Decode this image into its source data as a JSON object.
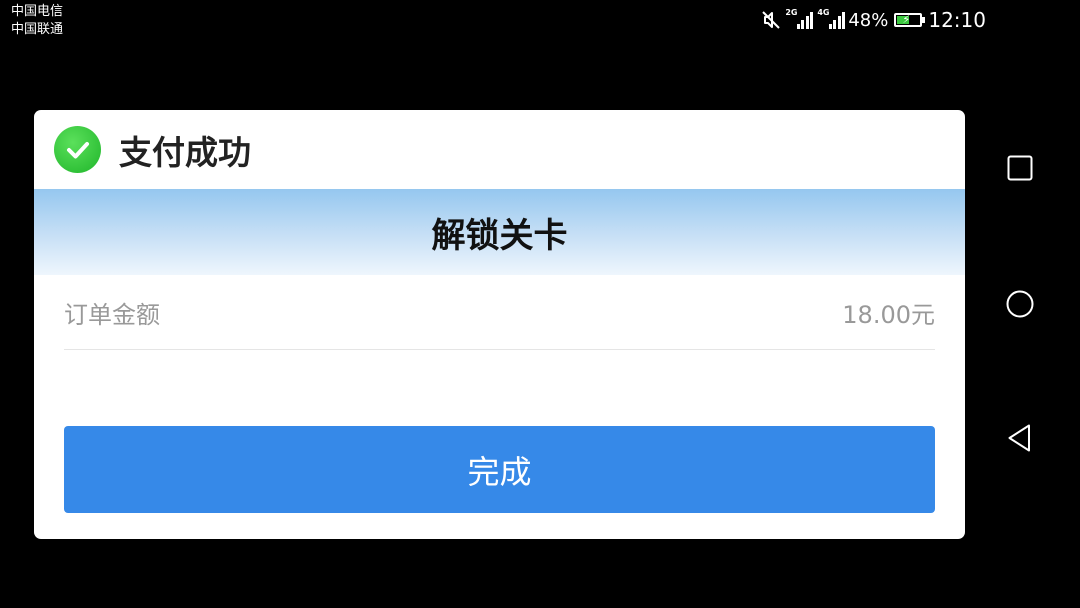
{
  "status_bar": {
    "carrier_1": "中国电信",
    "carrier_2": "中国联通",
    "sim1_network": "2G",
    "sim2_network": "4G",
    "battery_percent": "48%",
    "battery_level": 0.48,
    "time": "12:10",
    "icons": [
      "mute-icon",
      "signal-icon",
      "signal-icon",
      "battery-charging-icon"
    ]
  },
  "dialog": {
    "title": "支付成功",
    "status_icon": "check-circle-icon",
    "product_name": "解锁关卡",
    "amount_label": "订单金额",
    "amount_value": "18.00元",
    "done_label": "完成"
  },
  "nav_bar": {
    "icons": [
      "recent-apps-icon",
      "home-icon",
      "back-icon"
    ]
  },
  "colors": {
    "success_green": "#2ebd34",
    "button_blue": "#3689e8",
    "band_top": "#95c7ef",
    "band_bottom": "#eef6fd",
    "background": "#000000"
  }
}
